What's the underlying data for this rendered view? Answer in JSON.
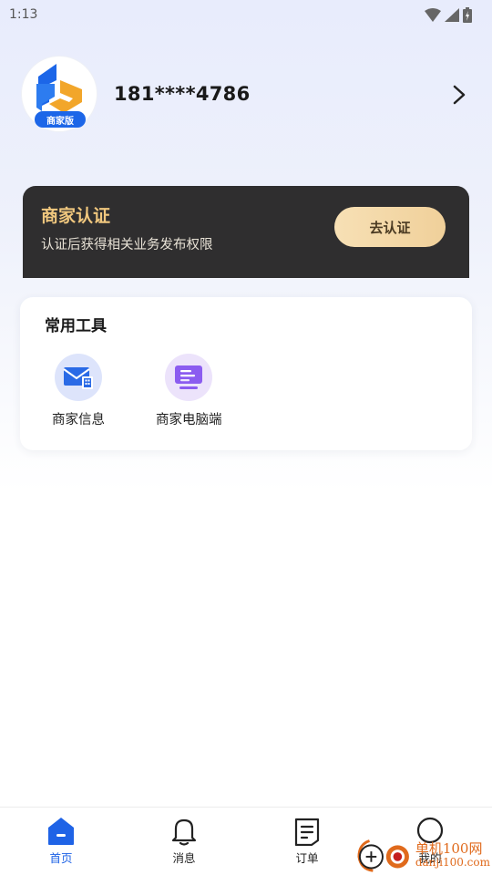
{
  "status_bar": {
    "time": "1:13",
    "icons": [
      "wifi-icon",
      "cell-signal-icon",
      "battery-icon"
    ]
  },
  "profile": {
    "phone": "181****4786",
    "avatar_badge": "商家版"
  },
  "cert_banner": {
    "title": "商家认证",
    "subtitle": "认证后获得相关业务发布权限",
    "button_label": "去认证"
  },
  "tools": {
    "title": "常用工具",
    "items": [
      {
        "label": "商家信息",
        "icon": "merchant-info-icon"
      },
      {
        "label": "商家电脑端",
        "icon": "merchant-pc-icon"
      }
    ]
  },
  "nav": {
    "items": [
      {
        "label": "首页",
        "icon": "home-icon",
        "active": true
      },
      {
        "label": "消息",
        "icon": "bell-icon",
        "active": false
      },
      {
        "label": "订单",
        "icon": "order-icon",
        "active": false
      },
      {
        "label": "我的",
        "icon": "profile-icon",
        "active": false
      }
    ]
  },
  "watermark": {
    "line1": "单机100网",
    "line2": "danji100.com"
  },
  "colors": {
    "accent": "#1f63e6",
    "cert_bg": "#2f2e2f",
    "cert_title": "#f0c77e",
    "cert_button": "#f3d7a6"
  }
}
